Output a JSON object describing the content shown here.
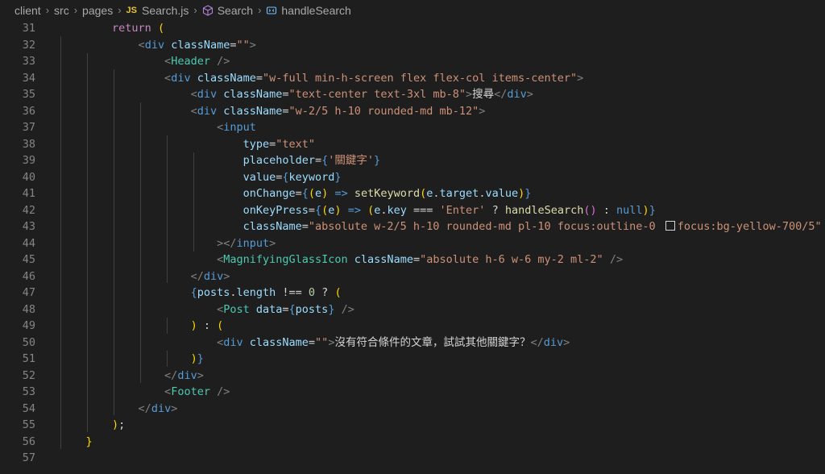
{
  "breadcrumb": {
    "items": [
      "client",
      "src",
      "pages",
      "Search.js",
      "Search",
      "handleSearch"
    ],
    "file_badge": "JS"
  },
  "line_numbers": [
    "31",
    "32",
    "33",
    "34",
    "35",
    "36",
    "37",
    "38",
    "39",
    "40",
    "41",
    "42",
    "43",
    "44",
    "45",
    "46",
    "47",
    "48",
    "49",
    "50",
    "51",
    "52",
    "53",
    "54",
    "55",
    "56",
    "57"
  ],
  "code": {
    "l31": [
      "return",
      "("
    ],
    "l32": [
      "<",
      "div",
      "className",
      "=",
      "\"\"",
      ">"
    ],
    "l33": [
      "<",
      "Header",
      "/>"
    ],
    "l34": [
      "<",
      "div",
      "className",
      "=",
      "\"w-full min-h-screen flex flex-col items-center\"",
      ">"
    ],
    "l35": [
      "<",
      "div",
      "className",
      "=",
      "\"text-center text-3xl mb-8\"",
      ">",
      "搜尋",
      "</",
      "div",
      ">"
    ],
    "l36": [
      "<",
      "div",
      "className",
      "=",
      "\"w-2/5 h-10 rounded-md mb-12\"",
      ">"
    ],
    "l37": [
      "<",
      "input"
    ],
    "l38": [
      "type",
      "=",
      "\"text\""
    ],
    "l39": [
      "placeholder",
      "=",
      "{",
      "'關鍵字'",
      "}"
    ],
    "l40": [
      "value",
      "=",
      "{",
      "keyword",
      "}"
    ],
    "l41": [
      "onChange",
      "=",
      "{",
      "(",
      "e",
      ")",
      " => ",
      "setKeyword",
      "(",
      "e",
      ".",
      "target",
      ".",
      "value",
      ")",
      "}"
    ],
    "l42": [
      "onKeyPress",
      "=",
      "{",
      "(",
      "e",
      ")",
      " => ",
      "(",
      "e",
      ".",
      "key",
      " === ",
      "'Enter'",
      " ? ",
      "handleSearch",
      "()",
      " : ",
      "null",
      ")",
      "}"
    ],
    "l43": [
      "className",
      "=",
      "\"absolute w-2/5 h-10 rounded-md pl-10 focus:outline-0 ",
      "focus:bg-yellow-700/5\""
    ],
    "l44": [
      "></",
      "input",
      ">"
    ],
    "l45": [
      "<",
      "MagnifyingGlassIcon",
      "className",
      "=",
      "\"absolute h-6 w-6 my-2 ml-2\"",
      "/>"
    ],
    "l46": [
      "</",
      "div",
      ">"
    ],
    "l47": [
      "{",
      "posts",
      ".",
      "length",
      " !== ",
      "0",
      " ? ",
      "("
    ],
    "l48": [
      "<",
      "Post",
      "data",
      "=",
      "{",
      "posts",
      "}",
      "/>"
    ],
    "l49": [
      ")",
      " : ",
      "("
    ],
    "l50": [
      "<",
      "div",
      "className",
      "=",
      "\"\"",
      ">",
      "沒有符合條件的文章，試試其他關鍵字？",
      "</",
      "div",
      ">"
    ],
    "l51": [
      ")",
      "}"
    ],
    "l52": [
      "</",
      "div",
      ">"
    ],
    "l53": [
      "<",
      "Footer",
      "/>"
    ],
    "l54": [
      "</",
      "div",
      ">"
    ],
    "l55": [
      ")",
      ";"
    ],
    "l56": [
      "}"
    ],
    "l57": []
  },
  "colors": {
    "background": "#1e1e1e",
    "keyword": "#c586c0",
    "tag": "#569cd6",
    "component": "#4ec9b0",
    "attribute": "#9cdcfe",
    "string": "#ce9178",
    "function": "#dcdcaa",
    "bracket_gold": "#ffd700",
    "bracket_purple": "#da70d6",
    "bracket_blue": "#179fff",
    "swatch_color": "#1e1e1e"
  },
  "icons": {
    "breadcrumb_sep": "chevron-right-icon",
    "component_icon": "cube-icon",
    "method_icon": "method-icon"
  }
}
